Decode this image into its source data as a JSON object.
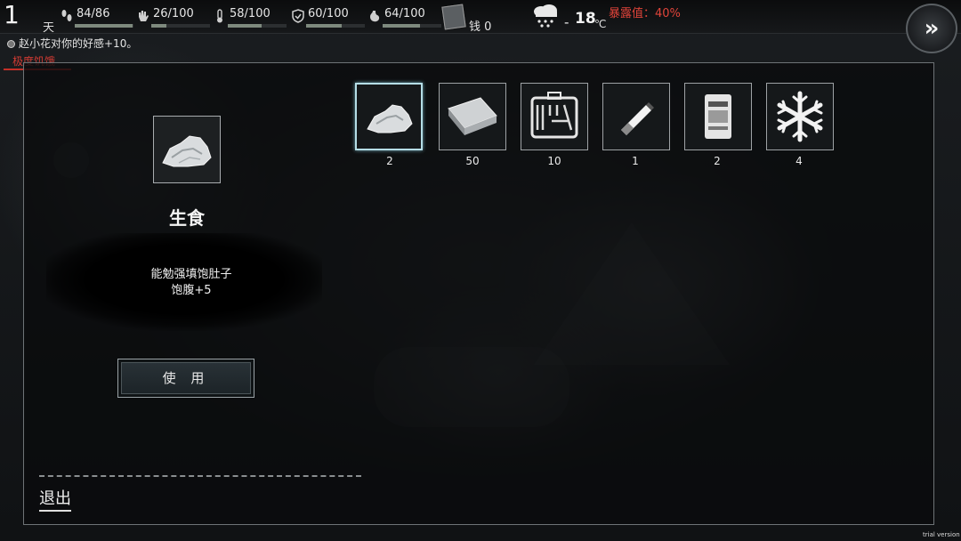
{
  "hud": {
    "day": "1",
    "day_unit": "天",
    "stats": [
      {
        "icon": "footprints-icon",
        "value": "84/86",
        "fill": 0.98
      },
      {
        "icon": "hand-icon",
        "value": "26/100",
        "fill": 0.26
      },
      {
        "icon": "thermometer-icon",
        "value": "58/100",
        "fill": 0.58
      },
      {
        "icon": "shield-icon",
        "value": "60/100",
        "fill": 0.6
      },
      {
        "icon": "stomach-icon",
        "value": "64/100",
        "fill": 0.64
      }
    ],
    "money": "钱 0",
    "weather_icon": "snow-cloud-icon",
    "temp_sign": "-",
    "temp_value": "18",
    "temp_unit": "℃",
    "exposure": "暴露值：40%"
  },
  "notice": "赵小花对你的好感+10。",
  "status_tag": "极度饥饿",
  "detail": {
    "name": "生食",
    "description_line1": "能勉强填饱肚子",
    "description_line2": "饱腹+5",
    "use_label": "使 用"
  },
  "inventory": [
    {
      "icon": "raw-meat-icon",
      "count": "2",
      "selected": true
    },
    {
      "icon": "cloth-icon",
      "count": "50",
      "selected": false
    },
    {
      "icon": "toolbox-icon",
      "count": "10",
      "selected": false
    },
    {
      "icon": "cigarette-icon",
      "count": "1",
      "selected": false
    },
    {
      "icon": "food-packet-icon",
      "count": "2",
      "selected": false
    },
    {
      "icon": "snowflake-icon",
      "count": "4",
      "selected": false
    }
  ],
  "exit_label": "退出",
  "watermark": "trial version",
  "colors": {
    "exposure": "#e0443a",
    "status": "#d23b33",
    "selected_border": "#b5dde6"
  }
}
